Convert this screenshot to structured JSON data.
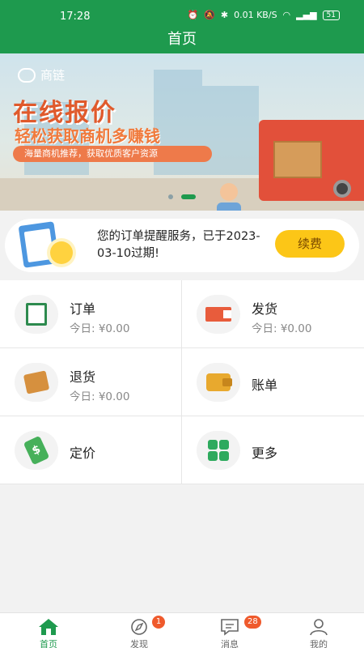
{
  "status_bar": {
    "time": "17:28",
    "network_speed": "0.01 KB/S",
    "battery": "51"
  },
  "header": {
    "title": "首页"
  },
  "banner": {
    "logo_text": "商链",
    "headline": "在线报价",
    "subline": "轻松获取商机多赚钱",
    "tagline": "海量商机推荐，获取优质客户资源",
    "page_indicator": {
      "count": 2,
      "active": 2
    }
  },
  "notice": {
    "text": "您的订单提醒服务，已于2023-03-10过期!",
    "renew_label": "续费"
  },
  "menu": {
    "items": [
      {
        "title": "订单",
        "subtitle": "今日: ¥0.00",
        "icon": "order-clipboard-icon"
      },
      {
        "title": "发货",
        "subtitle": "今日: ¥0.00",
        "icon": "delivery-truck-icon"
      },
      {
        "title": "退货",
        "subtitle": "今日: ¥0.00",
        "icon": "return-box-icon"
      },
      {
        "title": "账单",
        "subtitle": "",
        "icon": "wallet-icon"
      },
      {
        "title": "定价",
        "subtitle": "",
        "icon": "price-tag-icon"
      },
      {
        "title": "更多",
        "subtitle": "",
        "icon": "more-grid-icon"
      }
    ]
  },
  "tabbar": {
    "tabs": [
      {
        "label": "首页",
        "icon": "home-icon",
        "badge": ""
      },
      {
        "label": "发现",
        "icon": "compass-icon",
        "badge": "1"
      },
      {
        "label": "消息",
        "icon": "message-icon",
        "badge": "28"
      },
      {
        "label": "我的",
        "icon": "user-icon",
        "badge": ""
      }
    ]
  },
  "colors": {
    "brand_green": "#1e9a4e",
    "renew_yellow": "#fcc617",
    "badge_red": "#ef5a2c"
  }
}
